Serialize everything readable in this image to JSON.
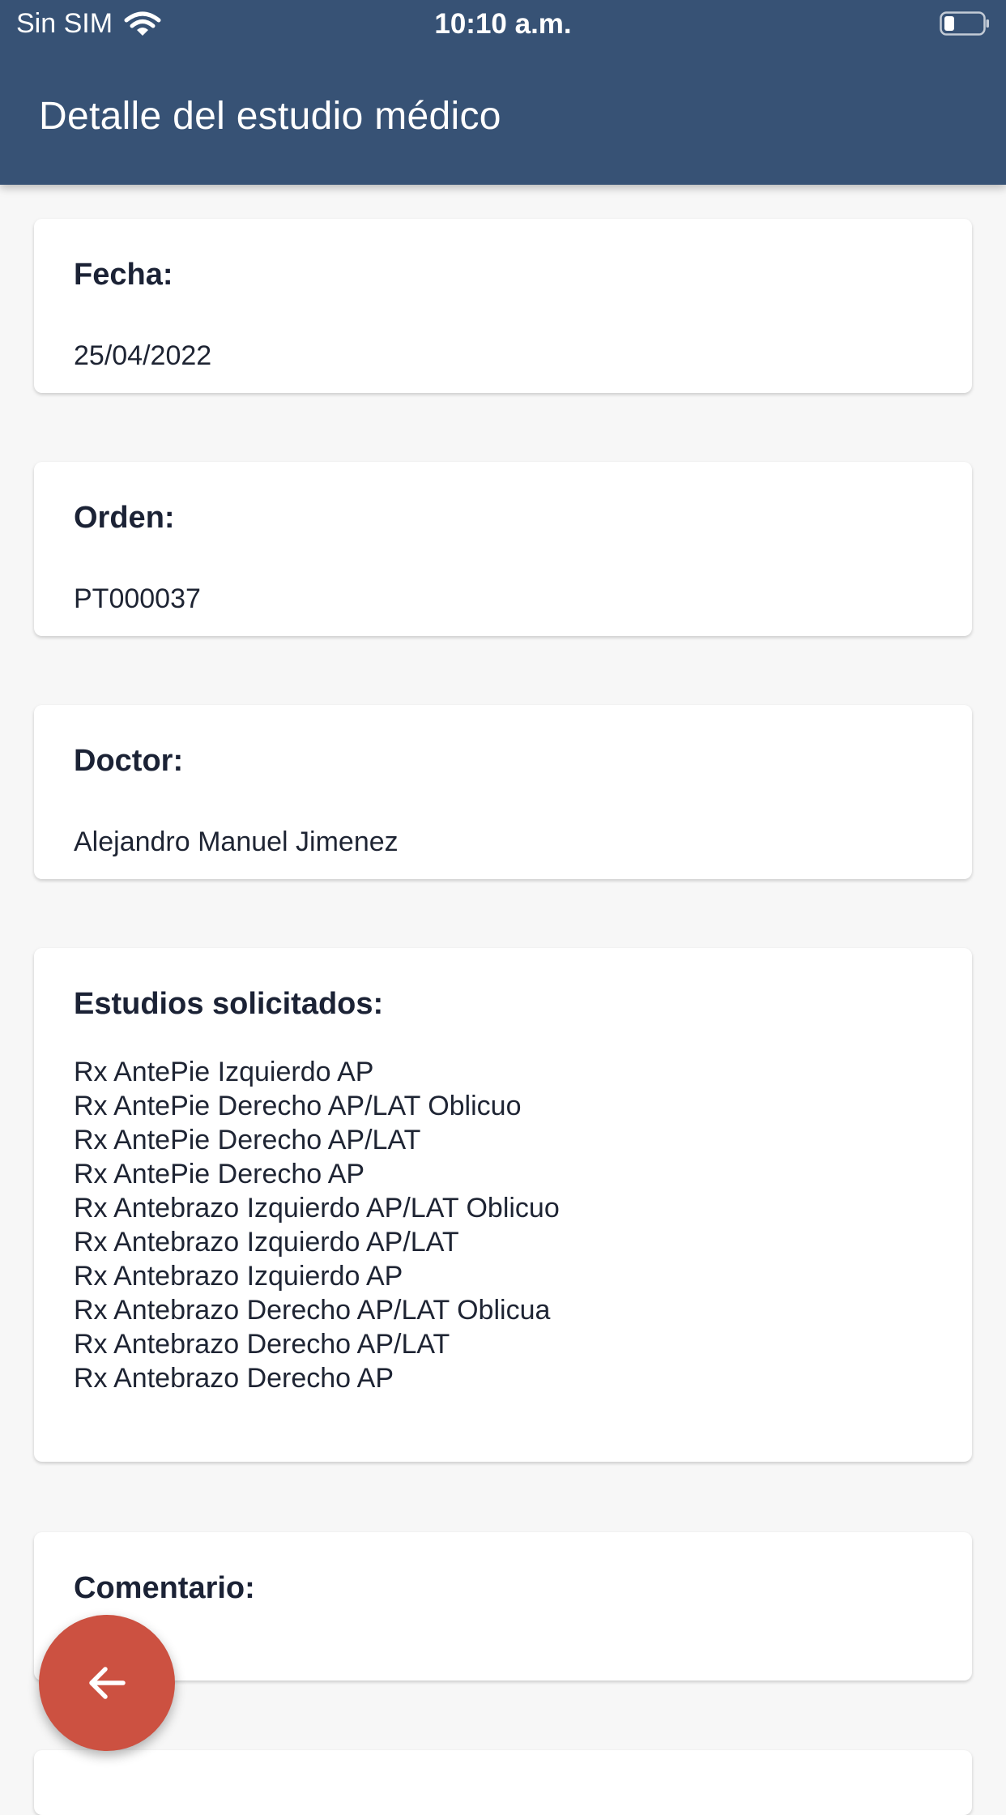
{
  "status_bar": {
    "carrier": "Sin SIM",
    "time": "10:10 a.m.",
    "wifi_icon": "wifi-icon",
    "battery_icon": "battery-low-icon"
  },
  "header": {
    "title": "Detalle del estudio médico",
    "background_color": "#375275"
  },
  "cards": {
    "fecha": {
      "label": "Fecha:",
      "value": "25/04/2022"
    },
    "orden": {
      "label": "Orden:",
      "value": "PT000037"
    },
    "doctor": {
      "label": "Doctor:",
      "value": "Alejandro Manuel Jimenez"
    },
    "estudios": {
      "label": "Estudios solicitados:",
      "items": [
        "Rx AntePie Izquierdo AP",
        "Rx AntePie Derecho AP/LAT Oblicuo",
        "Rx AntePie Derecho AP/LAT",
        "Rx AntePie Derecho AP",
        "Rx Antebrazo Izquierdo AP/LAT Oblicuo",
        "Rx Antebrazo Izquierdo AP/LAT",
        "Rx Antebrazo Izquierdo AP",
        "Rx Antebrazo Derecho AP/LAT Oblicua",
        "Rx Antebrazo Derecho AP/LAT",
        "Rx Antebrazo Derecho AP"
      ]
    },
    "comentario": {
      "label": "Comentario:",
      "value": ""
    }
  },
  "fab": {
    "icon": "arrow-left-icon",
    "color": "#cc5141"
  }
}
